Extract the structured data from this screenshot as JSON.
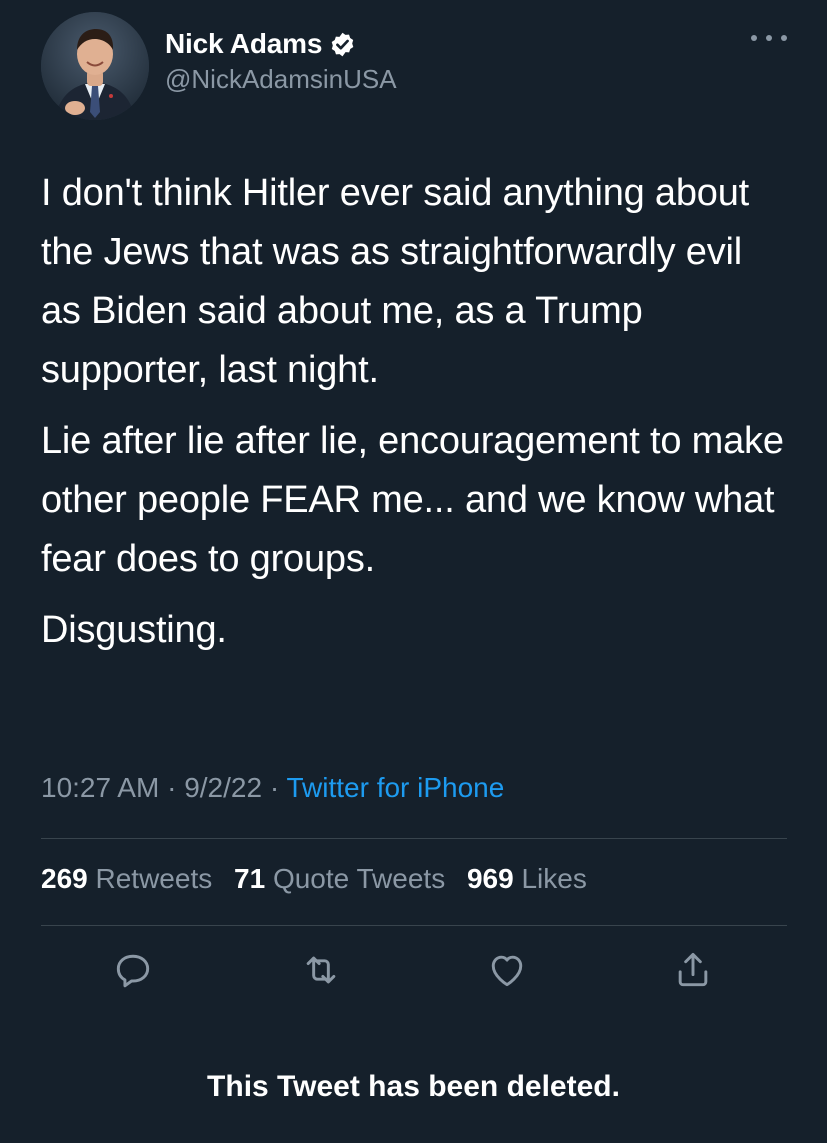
{
  "user": {
    "display_name": "Nick Adams",
    "handle": "@NickAdamsinUSA",
    "avatar_icon": "profile-photo",
    "verified_icon": "verified-badge-icon"
  },
  "tweet": {
    "paragraphs": [
      "I don't think Hitler ever said anything about the Jews that was as straightforwardly evil as Biden said about me, as a Trump supporter, last night.",
      "Lie after lie after lie, encouragement to make other people FEAR me... and we know what fear does to groups.",
      "Disgusting."
    ],
    "time": "10:27 AM",
    "date": "9/2/22",
    "separator": "·",
    "source": "Twitter for iPhone"
  },
  "stats": {
    "retweets_count": "269",
    "retweets_label": "Retweets",
    "quotes_count": "71",
    "quotes_label": "Quote Tweets",
    "likes_count": "969",
    "likes_label": "Likes"
  },
  "actions": [
    "reply-icon",
    "retweet-icon",
    "like-icon",
    "share-icon"
  ],
  "banner": {
    "deleted_text": "This Tweet has been deleted."
  },
  "colors": {
    "background": "#15202b",
    "text": "#ffffff",
    "secondary": "#8b98a5",
    "link": "#1d9bf0",
    "divider": "#38444d"
  }
}
